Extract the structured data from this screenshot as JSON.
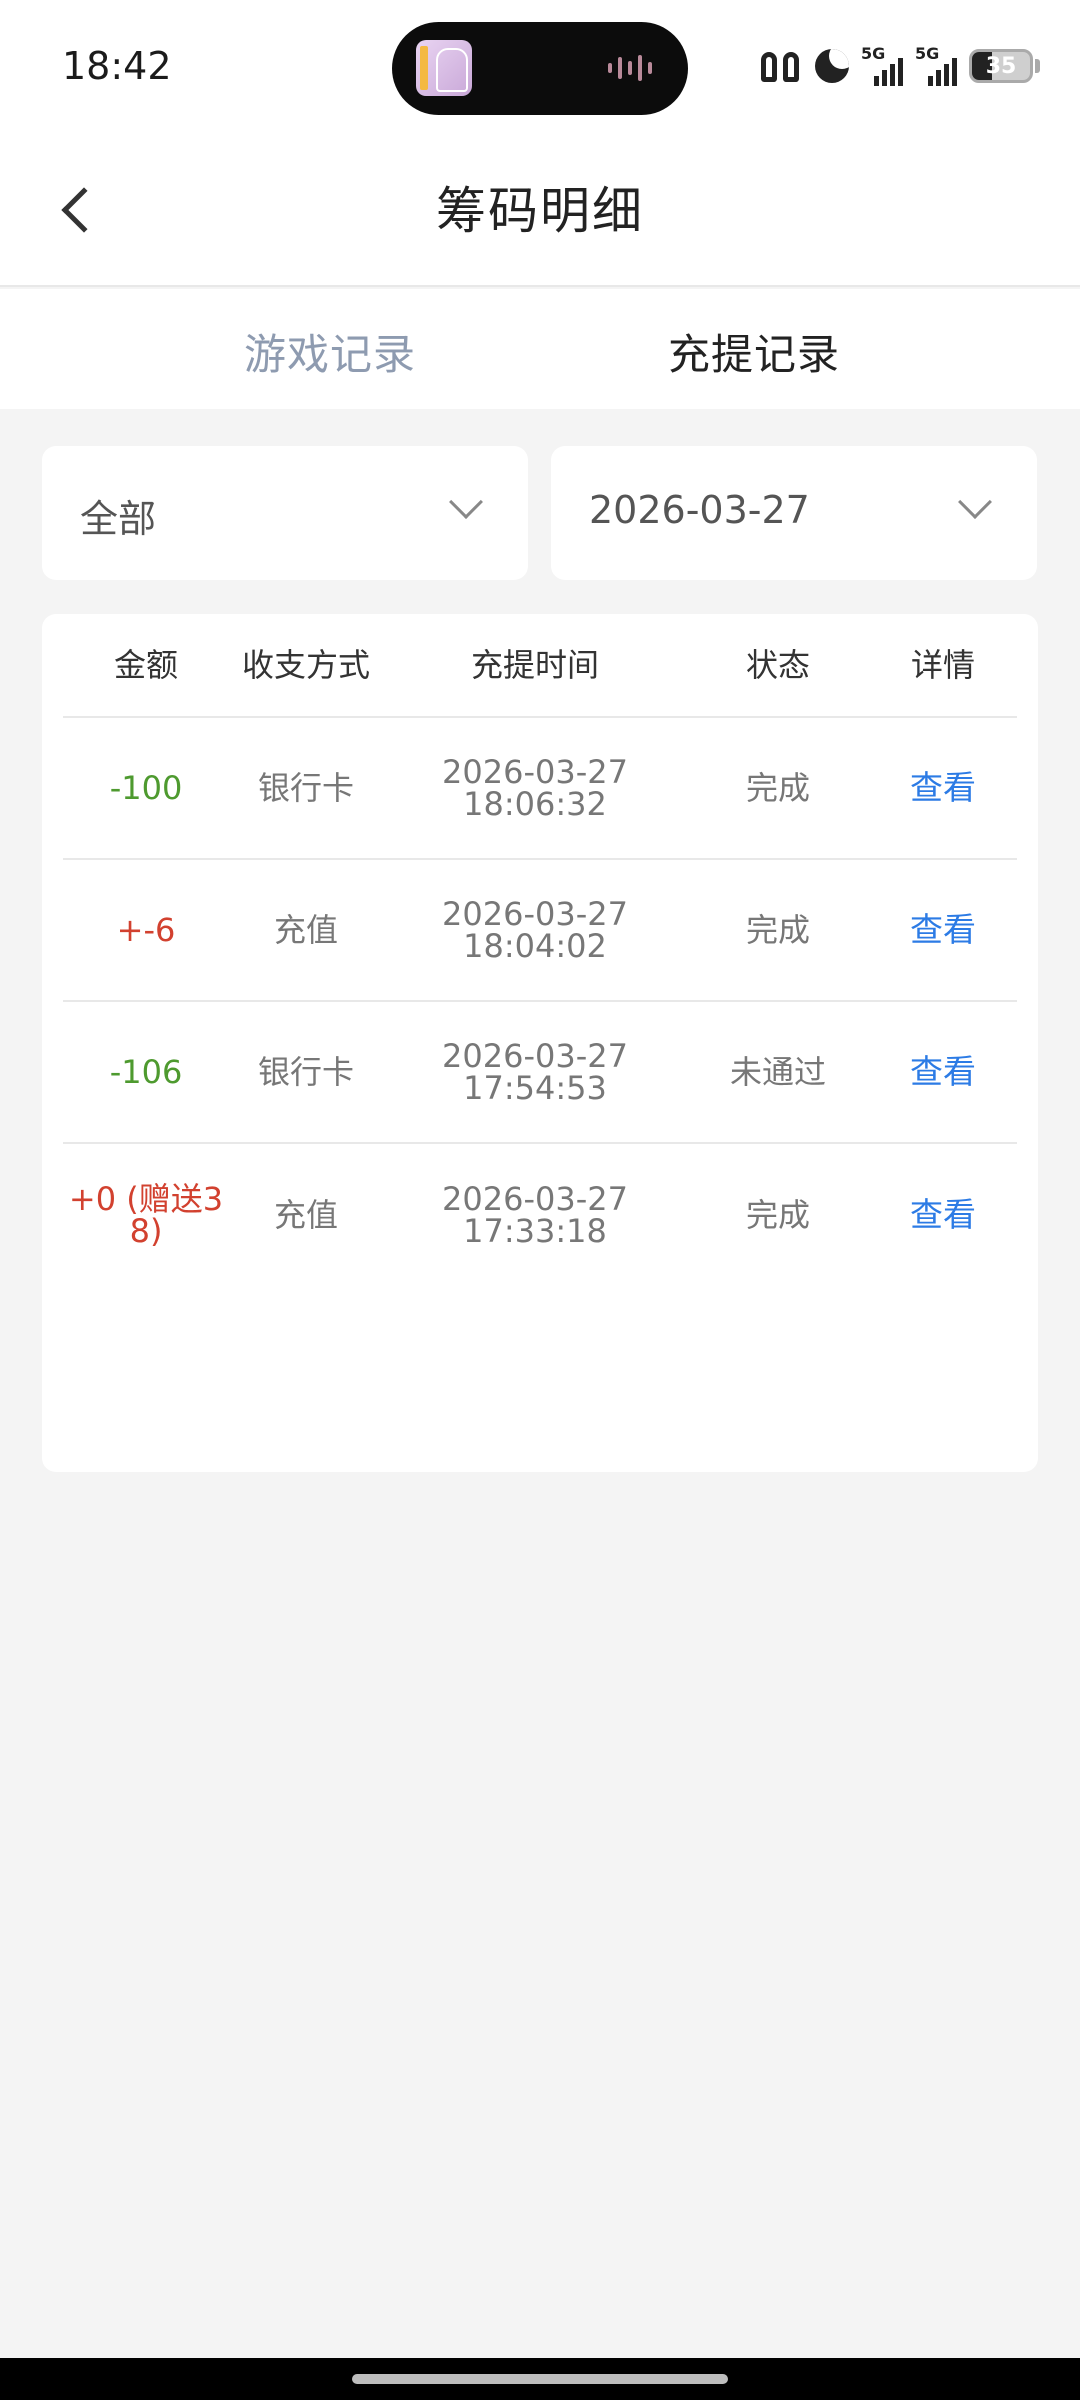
{
  "status_bar": {
    "time": "18:42",
    "signal_1": "5G",
    "signal_2": "5G",
    "battery": "35"
  },
  "header": {
    "title": "筹码明细"
  },
  "tabs": [
    {
      "label": "游戏记录",
      "active": false
    },
    {
      "label": "充提记录",
      "active": true
    }
  ],
  "filters": {
    "type": "全部",
    "date": "2026-03-27"
  },
  "table": {
    "columns": [
      "金额",
      "收支方式",
      "充提时间",
      "状态",
      "详情"
    ],
    "rows": [
      {
        "amount": "-100",
        "method": "银行卡",
        "date": "2026-03-27",
        "time": "18:06:32",
        "status": "完成",
        "detail": "查看"
      },
      {
        "amount": "+-6",
        "method": "充值",
        "date": "2026-03-27",
        "time": "18:04:02",
        "status": "完成",
        "detail": "查看"
      },
      {
        "amount": "-106",
        "method": "银行卡",
        "date": "2026-03-27",
        "time": "17:54:53",
        "status": "未通过",
        "detail": "查看"
      },
      {
        "amount": "+0 (赠送38)",
        "amount_line1": "+0 (赠送3",
        "amount_line2": "8)",
        "method": "充值",
        "date": "2026-03-27",
        "time": "17:33:18",
        "status": "完成",
        "detail": "查看"
      }
    ]
  },
  "colors": {
    "negative": "#4e9a2f",
    "positive": "#d2412f",
    "link": "#2c7be5",
    "inactive_tab": "#8e9bb0"
  }
}
